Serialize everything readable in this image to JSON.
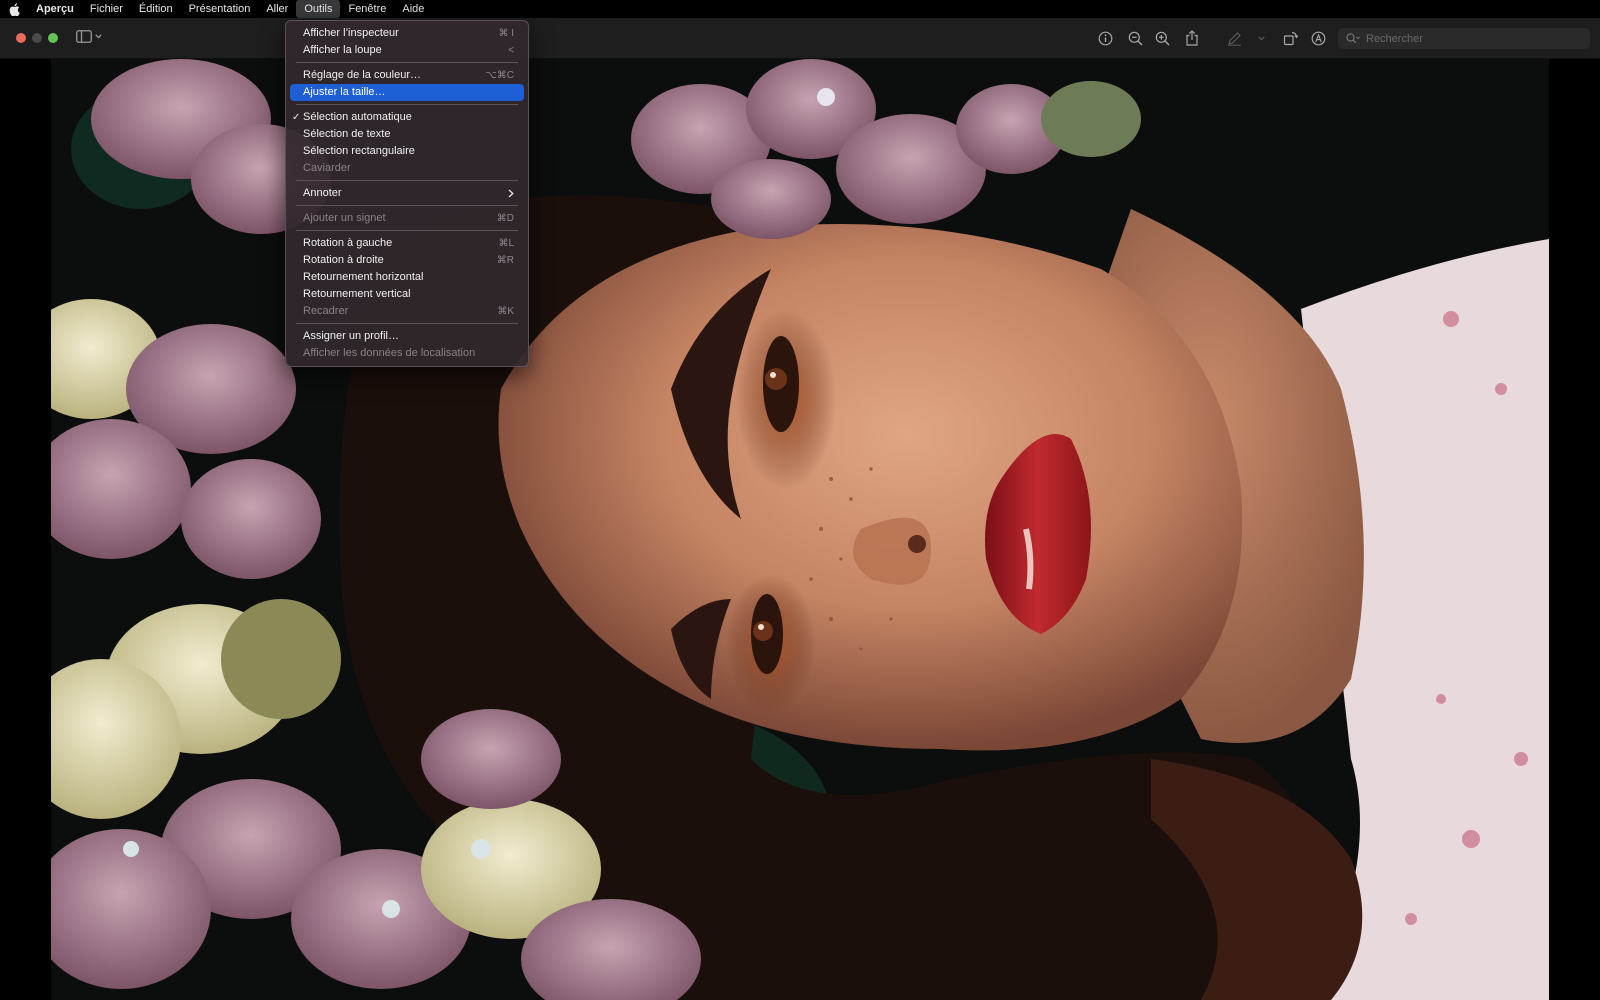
{
  "menubar": {
    "items": [
      {
        "label": "Aperçu"
      },
      {
        "label": "Fichier"
      },
      {
        "label": "Édition"
      },
      {
        "label": "Présentation"
      },
      {
        "label": "Aller"
      },
      {
        "label": "Outils"
      },
      {
        "label": "Fenêtre"
      },
      {
        "label": "Aide"
      }
    ],
    "active": "Outils"
  },
  "toolbar": {
    "search_placeholder": "Rechercher",
    "icons": [
      "info-icon",
      "zoom-out-icon",
      "zoom-in-icon",
      "share-icon",
      "markup-pen-icon",
      "chevron-down-icon",
      "rotate-icon",
      "annotate-icon"
    ]
  },
  "menu": {
    "items": [
      {
        "label": "Afficher l’inspecteur",
        "shortcut": "⌘ I"
      },
      {
        "label": "Afficher la loupe",
        "shortcut": "<"
      },
      {
        "label": "Réglage de la couleur…",
        "shortcut": "⌥⌘C"
      },
      {
        "label": "Ajuster la taille…",
        "shortcut": ""
      },
      {
        "label": "Sélection automatique",
        "shortcut": "",
        "check": "✓"
      },
      {
        "label": "Sélection de texte",
        "shortcut": ""
      },
      {
        "label": "Sélection rectangulaire",
        "shortcut": ""
      },
      {
        "label": "Caviarder",
        "shortcut": ""
      },
      {
        "label": "Annoter",
        "shortcut": ""
      },
      {
        "label": "Ajouter un signet",
        "shortcut": "⌘D"
      },
      {
        "label": "Rotation à gauche",
        "shortcut": "⌘L"
      },
      {
        "label": "Rotation à droite",
        "shortcut": "⌘R"
      },
      {
        "label": "Retournement horizontal",
        "shortcut": ""
      },
      {
        "label": "Retournement vertical",
        "shortcut": ""
      },
      {
        "label": "Recadrer",
        "shortcut": "⌘K"
      },
      {
        "label": "Assigner un profil…",
        "shortcut": ""
      },
      {
        "label": "Afficher les données de localisation",
        "shortcut": ""
      }
    ]
  },
  "colors": {
    "highlight": "#1f5fd6",
    "close": "#ed6a5e",
    "maximize": "#61c554"
  }
}
